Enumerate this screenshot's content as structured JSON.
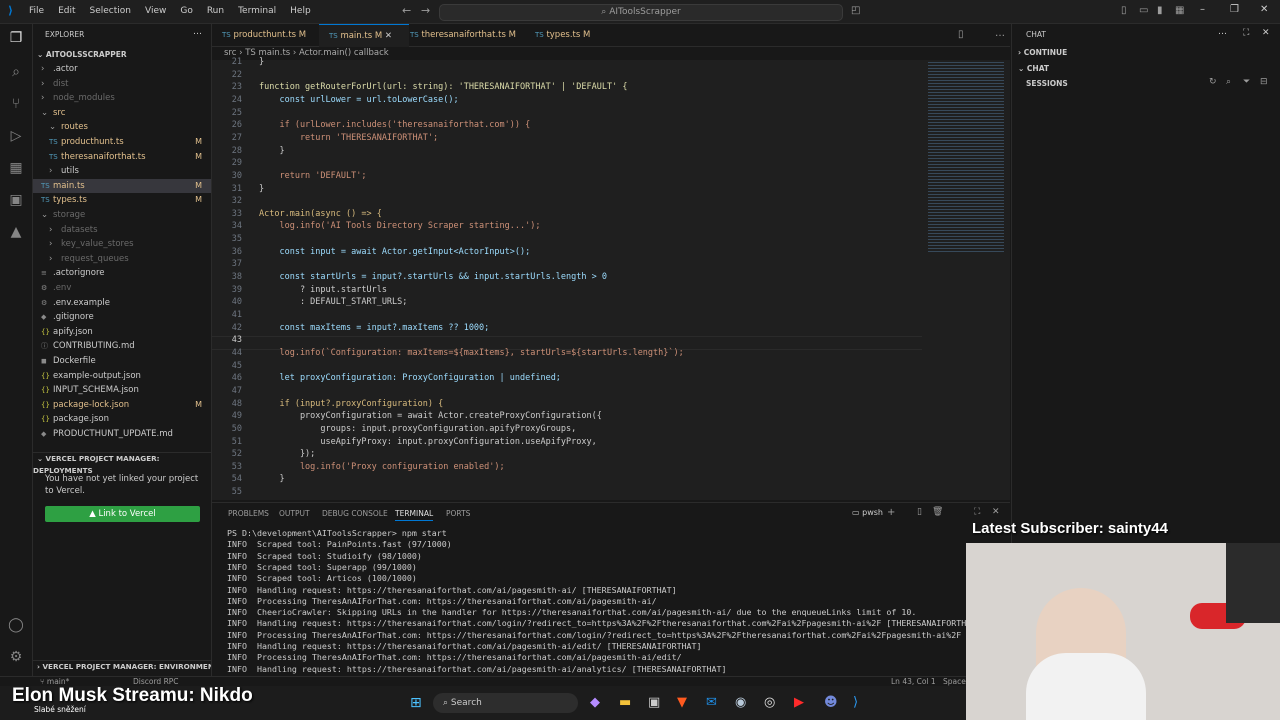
{
  "titlebar": {
    "menus": [
      "File",
      "Edit",
      "Selection",
      "View",
      "Go",
      "Run",
      "Terminal",
      "Help"
    ],
    "search_text": "AIToolsScrapper"
  },
  "sidebar": {
    "header": "EXPLORER",
    "project": "AITOOLSSCRAPPER",
    "rows": [
      {
        "label": ".actor",
        "badge": ""
      },
      {
        "label": "dist",
        "badge": ""
      },
      {
        "label": "node_modules",
        "badge": ""
      },
      {
        "label": "src",
        "badge": ""
      },
      {
        "label": "routes",
        "badge": ""
      },
      {
        "label": "producthunt.ts",
        "badge": "M"
      },
      {
        "label": "theresanaiforthat.ts",
        "badge": "M"
      },
      {
        "label": "utils",
        "badge": ""
      },
      {
        "label": "main.ts",
        "badge": "M"
      },
      {
        "label": "types.ts",
        "badge": "M"
      },
      {
        "label": "storage",
        "badge": ""
      },
      {
        "label": "datasets",
        "badge": ""
      },
      {
        "label": "key_value_stores",
        "badge": ""
      },
      {
        "label": "request_queues",
        "badge": ""
      },
      {
        "label": ".actorignore",
        "badge": ""
      },
      {
        "label": ".env",
        "badge": ""
      },
      {
        "label": ".env.example",
        "badge": ""
      },
      {
        "label": ".gitignore",
        "badge": ""
      },
      {
        "label": "apify.json",
        "badge": ""
      },
      {
        "label": "CONTRIBUTING.md",
        "badge": ""
      },
      {
        "label": "Dockerfile",
        "badge": ""
      },
      {
        "label": "example-output.json",
        "badge": ""
      },
      {
        "label": "INPUT_SCHEMA.json",
        "badge": ""
      },
      {
        "label": "package-lock.json",
        "badge": "M"
      },
      {
        "label": "package.json",
        "badge": ""
      },
      {
        "label": "PRODUCTHUNT_UPDATE.md",
        "badge": ""
      }
    ],
    "vercel_header": "VERCEL PROJECT MANAGER: DEPLOYMENTS",
    "vercel_text": "You have not yet linked your project to Vercel.",
    "vercel_button": "▲ Link to Vercel",
    "vercel_env_header": "VERCEL PROJECT MANAGER: ENVIRONMENT ..."
  },
  "editor": {
    "tabs": [
      "producthunt.ts M",
      "main.ts M",
      "theresanaiforthat.ts M",
      "types.ts M"
    ],
    "breadcrumb": "src  ›  TS main.ts  ›  Actor.main() callback",
    "lines": [
      {
        "n": "21",
        "t": "}"
      },
      {
        "n": "22",
        "t": ""
      },
      {
        "n": "23",
        "t": "function getRouterForUrl(url: string): 'THERESANAIFORTHAT' | 'DEFAULT' {"
      },
      {
        "n": "24",
        "t": "    const urlLower = url.toLowerCase();"
      },
      {
        "n": "25",
        "t": ""
      },
      {
        "n": "26",
        "t": "    if (urlLower.includes('theresanaiforthat.com')) {"
      },
      {
        "n": "27",
        "t": "        return 'THERESANAIFORTHAT';"
      },
      {
        "n": "28",
        "t": "    }"
      },
      {
        "n": "29",
        "t": ""
      },
      {
        "n": "30",
        "t": "    return 'DEFAULT';"
      },
      {
        "n": "31",
        "t": "}"
      },
      {
        "n": "32",
        "t": ""
      },
      {
        "n": "33",
        "t": "Actor.main(async () => {"
      },
      {
        "n": "34",
        "t": "    log.info('AI Tools Directory Scraper starting...');"
      },
      {
        "n": "35",
        "t": ""
      },
      {
        "n": "36",
        "t": "    const input = await Actor.getInput<ActorInput>();"
      },
      {
        "n": "37",
        "t": ""
      },
      {
        "n": "38",
        "t": "    const startUrls = input?.startUrls && input.startUrls.length > 0"
      },
      {
        "n": "39",
        "t": "        ? input.startUrls"
      },
      {
        "n": "40",
        "t": "        : DEFAULT_START_URLS;"
      },
      {
        "n": "41",
        "t": ""
      },
      {
        "n": "42",
        "t": "    const maxItems = input?.maxItems ?? 1000;"
      },
      {
        "n": "43",
        "t": ""
      },
      {
        "n": "44",
        "t": "    log.info(`Configuration: maxItems=${maxItems}, startUrls=${startUrls.length}`);"
      },
      {
        "n": "45",
        "t": ""
      },
      {
        "n": "46",
        "t": "    let proxyConfiguration: ProxyConfiguration | undefined;"
      },
      {
        "n": "47",
        "t": ""
      },
      {
        "n": "48",
        "t": "    if (input?.proxyConfiguration) {"
      },
      {
        "n": "49",
        "t": "        proxyConfiguration = await Actor.createProxyConfiguration({"
      },
      {
        "n": "50",
        "t": "            groups: input.proxyConfiguration.apifyProxyGroups,"
      },
      {
        "n": "51",
        "t": "            useApifyProxy: input.proxyConfiguration.useApifyProxy,"
      },
      {
        "n": "52",
        "t": "        });"
      },
      {
        "n": "53",
        "t": "        log.info('Proxy configuration enabled');"
      },
      {
        "n": "54",
        "t": "    }"
      },
      {
        "n": "55",
        "t": ""
      }
    ]
  },
  "panel": {
    "tabs": [
      "PROBLEMS",
      "OUTPUT",
      "DEBUG CONSOLE",
      "TERMINAL",
      "PORTS"
    ],
    "shell": "pwsh",
    "lines": [
      "PS D:\\development\\AIToolsScrapper> npm start",
      "INFO  Scraped tool: PainPoints.fast (97/1000)",
      "INFO  Scraped tool: Studioify (98/1000)",
      "INFO  Scraped tool: Superapp (99/1000)",
      "INFO  Scraped tool: Articos (100/1000)",
      "INFO  Handling request: https://theresanaiforthat.com/ai/pagesmith-ai/ [THERESANAIFORTHAT]",
      "INFO  Processing TheresAnAIForThat.com: https://theresanaiforthat.com/ai/pagesmith-ai/",
      "INFO  CheerioCrawler: Skipping URLs in the handler for https://theresanaiforthat.com/ai/pagesmith-ai/ due to the enqueueLinks limit of 10.",
      "INFO  Handling request: https://theresanaiforthat.com/login/?redirect_to=https%3A%2F%2Ftheresanaiforthat.com%2Fai%2Fpagesmith-ai%2F [THERESANAIFORTHAT]",
      "INFO  Processing TheresAnAIForThat.com: https://theresanaiforthat.com/login/?redirect_to=https%3A%2F%2Ftheresanaiforthat.com%2Fai%2Fpagesmith-ai%2F",
      "INFO  Handling request: https://theresanaiforthat.com/ai/pagesmith-ai/edit/ [THERESANAIFORTHAT]",
      "INFO  Processing TheresAnAIForThat.com: https://theresanaiforthat.com/ai/pagesmith-ai/edit/",
      "INFO  Handling request: https://theresanaiforthat.com/ai/pagesmith-ai/analytics/ [THERESANAIFORTHAT]"
    ]
  },
  "chat": {
    "title": "CHAT",
    "continue": "CONTINUE",
    "chat_section": "CHAT",
    "sessions": "SESSIONS"
  },
  "statusbar": {
    "branch": "main*",
    "discord": "Discord RPC",
    "position": "Ln 43, Col 1",
    "spaces": "Spaces"
  },
  "taskbar": {
    "search": "Search"
  },
  "overlay": {
    "subscriber": "Latest Subscriber: sainty44",
    "stream_title": "Elon Musk Streamu: Nikdo",
    "stream_subtitle": "Slabé sněžení"
  },
  "colors": {
    "accent": "#0078d4",
    "modified": "#e2c08d",
    "vercel_green": "#2ea043"
  }
}
